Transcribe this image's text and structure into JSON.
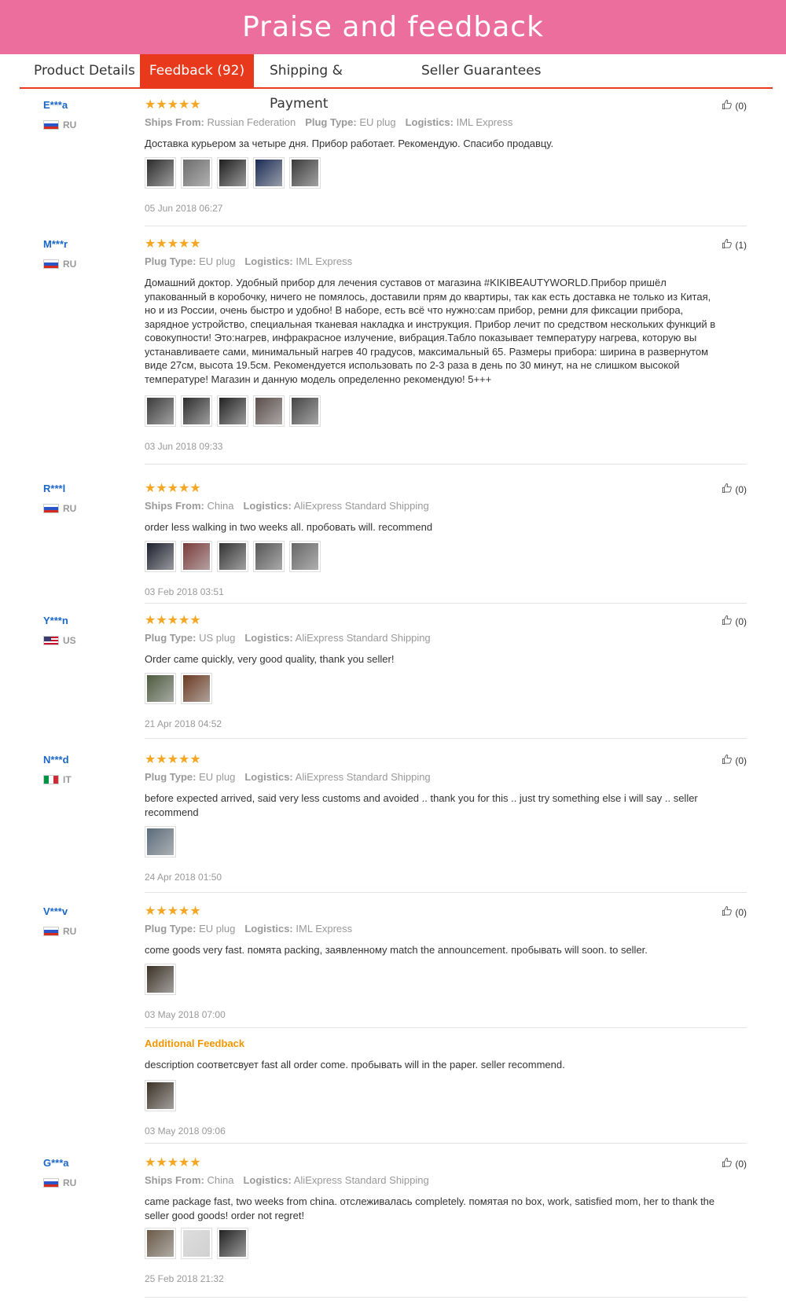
{
  "banner": {
    "title": "Praise and feedback"
  },
  "tabs": [
    {
      "label": "Product Details"
    },
    {
      "label": "Feedback (92)"
    },
    {
      "label": "Shipping & Payment"
    },
    {
      "label": "Seller Guarantees"
    }
  ],
  "reviews": [
    {
      "user": "E***a",
      "country": "RU",
      "stars": "★★★★★",
      "like": "(0)",
      "meta": [
        {
          "k": "Ships From:",
          "v": "Russian Federation"
        },
        {
          "k": "Plug Type:",
          "v": "EU plug"
        },
        {
          "k": "Logistics:",
          "v": "IML Express"
        }
      ],
      "text": "Доставка курьером за четыре дня. Прибор работает. Рекомендую. Спасибо продавцу.",
      "date": "05 Jun 2018 06:27"
    },
    {
      "user": "M***r",
      "country": "RU",
      "stars": "★★★★★",
      "like": "(1)",
      "meta": [
        {
          "k": "Plug Type:",
          "v": "EU plug"
        },
        {
          "k": "Logistics:",
          "v": "IML Express"
        }
      ],
      "text": "Домашний доктор. Удобный прибор для лечения суставов от магазина #KIKIBEAUTYWORLD.Прибор пришёл упакованный в коробочку, ничего не помялось, доставили прям до квартиры, так как есть доставка не только из Китая, но и из России, очень быстро и удобно! В наборе, есть всё что нужно:сам прибор, ремни для фиксации прибора, зарядное устройство, специальная тканевая накладка и инструкция. Прибор лечит по средством нескольких функций в совокупности! Это:нагрев, инфракрасное излучение, вибрация.Табло показывает температуру нагрева, которую вы устанавливаете сами, минимальный нагрев 40 градусов, максимальный 65. Размеры прибора: ширина в развернутом виде 27см, высота 19.5см. Рекомендуется использовать по 2-3 раза в день по 30 минут, на не слишком высокой температуре! Магазин и данную модель определенно рекомендую! 5+++",
      "date": "03 Jun 2018 09:33"
    },
    {
      "user": "R***l",
      "country": "RU",
      "stars": "★★★★★",
      "like": "(0)",
      "meta": [
        {
          "k": "Ships From:",
          "v": "China"
        },
        {
          "k": "Logistics:",
          "v": "AliExpress Standard Shipping"
        }
      ],
      "text": "order less walking in two weeks all. пробовать will. recommend",
      "date": "03 Feb 2018 03:51"
    },
    {
      "user": "Y***n",
      "country": "US",
      "stars": "★★★★★",
      "like": "(0)",
      "meta": [
        {
          "k": "Plug Type:",
          "v": "US plug"
        },
        {
          "k": "Logistics:",
          "v": "AliExpress Standard Shipping"
        }
      ],
      "text": "Order came quickly, very good quality, thank you seller!",
      "date": "21 Apr 2018 04:52"
    },
    {
      "user": "N***d",
      "country": "IT",
      "stars": "★★★★★",
      "like": "(0)",
      "meta": [
        {
          "k": "Plug Type:",
          "v": "EU plug"
        },
        {
          "k": "Logistics:",
          "v": "AliExpress Standard Shipping"
        }
      ],
      "text": "before expected arrived, said very less customs and avoided .. thank you for this .. just try something else i will say .. seller recommend",
      "date": "24 Apr 2018 01:50"
    },
    {
      "user": "V***v",
      "country": "RU",
      "stars": "★★★★★",
      "like": "(0)",
      "meta": [
        {
          "k": "Plug Type:",
          "v": "EU plug"
        },
        {
          "k": "Logistics:",
          "v": "IML Express"
        }
      ],
      "text": "come goods very fast. помята packing, заявленному match the announcement. пробывать will soon. to seller.",
      "date": "03 May 2018 07:00",
      "additional_label": "Additional Feedback",
      "additional_text": "description соответсвует fast all order come. пробывать will in the paper. seller recommend.",
      "additional_date": "03 May 2018 09:06"
    },
    {
      "user": "G***a",
      "country": "RU",
      "stars": "★★★★★",
      "like": "(0)",
      "meta": [
        {
          "k": "Ships From:",
          "v": "China"
        },
        {
          "k": "Logistics:",
          "v": "AliExpress Standard Shipping"
        }
      ],
      "text": "came package fast, two weeks from china. отслеживалась completely. помятая no box, work, satisfied mom, her to thank the seller good goods! order not regret!",
      "date": "25 Feb 2018 21:32"
    }
  ]
}
